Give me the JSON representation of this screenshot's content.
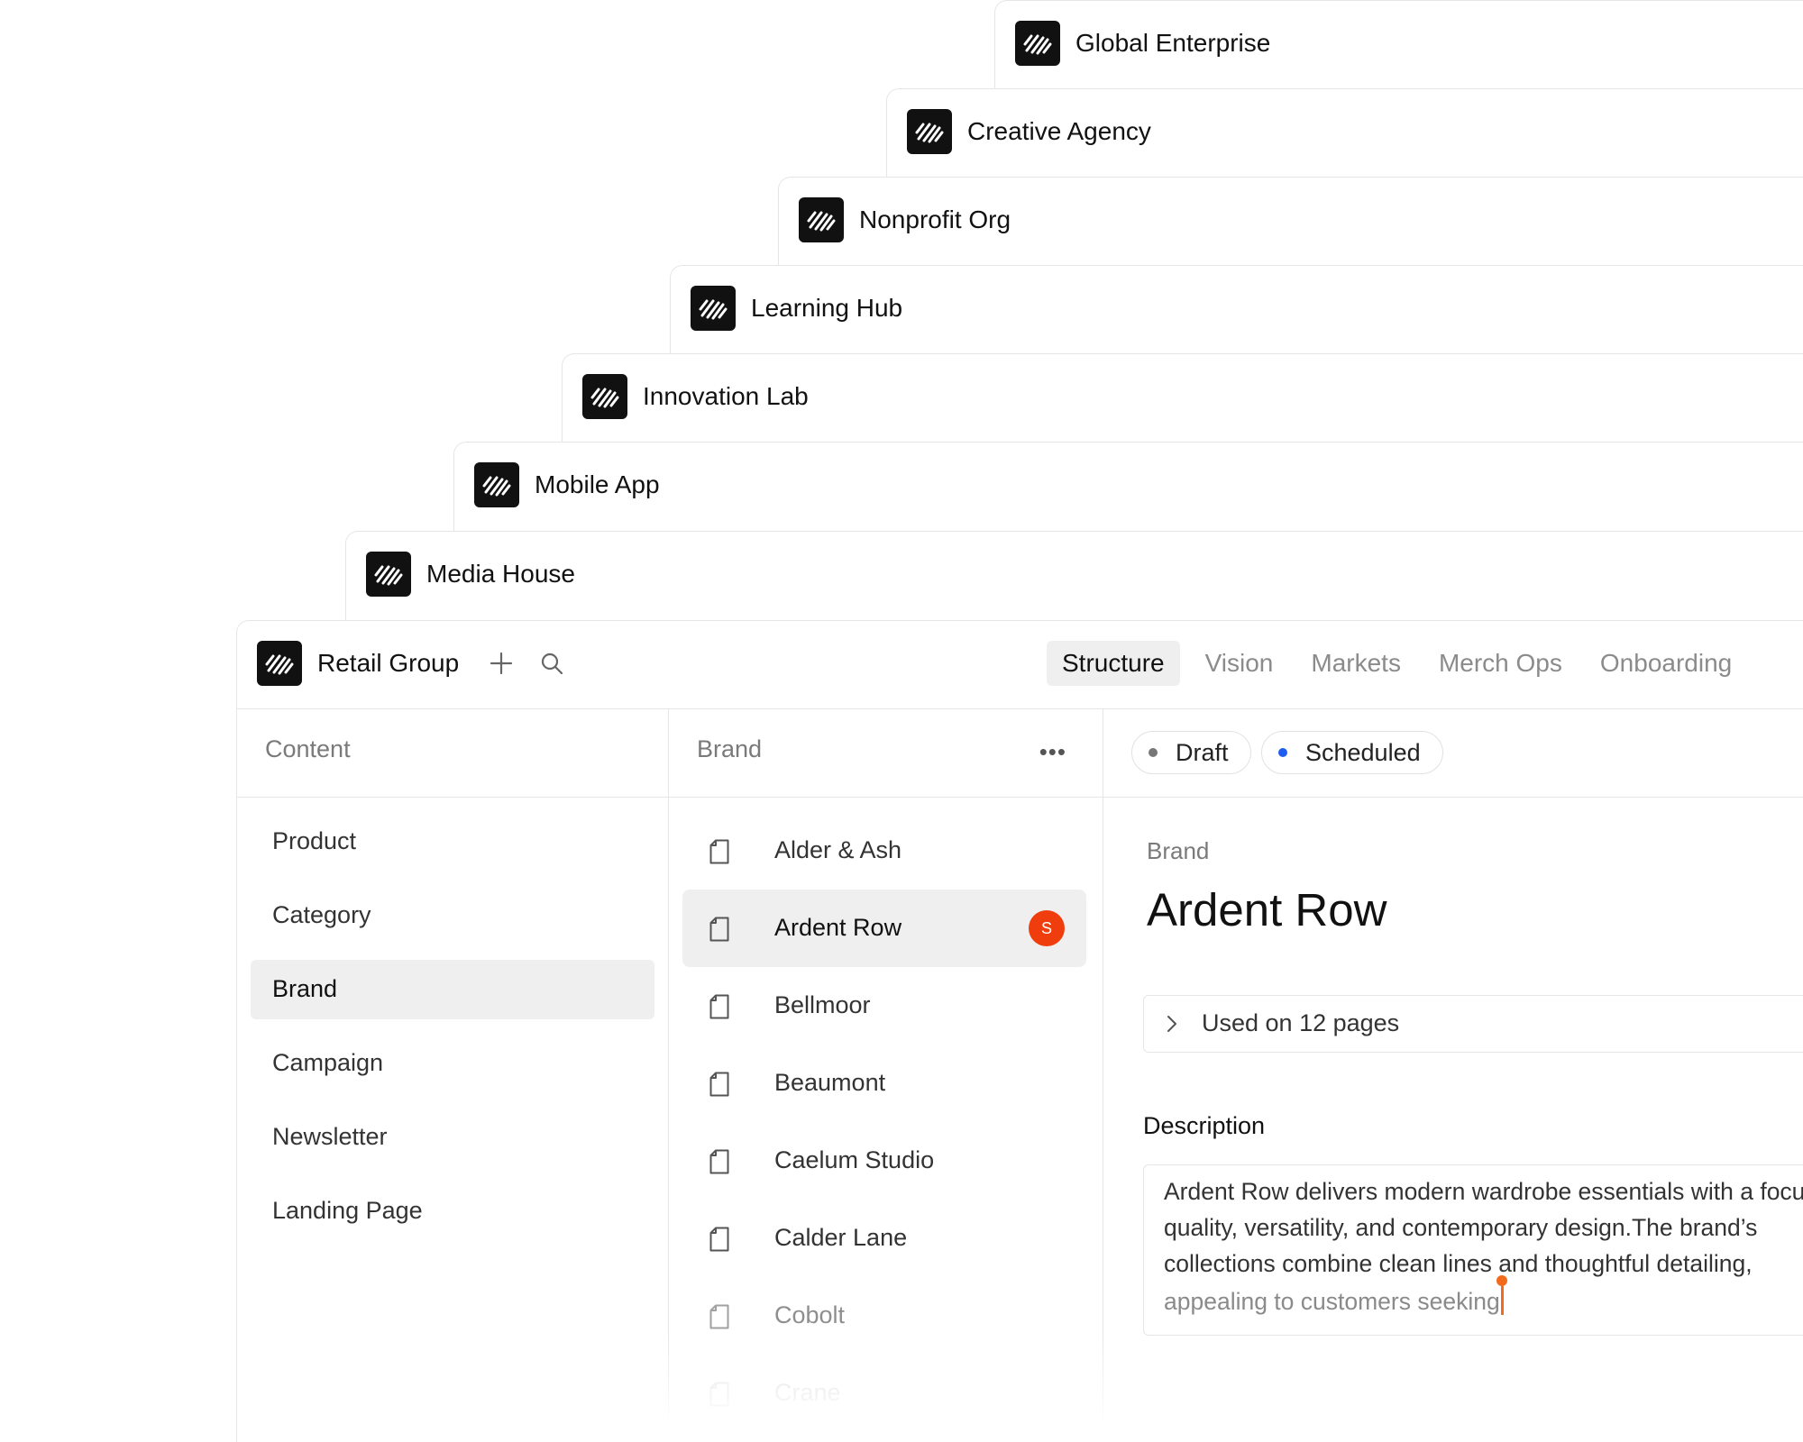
{
  "workspaces": [
    {
      "name": "Global Enterprise",
      "icon": "workspace-logo-icon"
    },
    {
      "name": "Creative Agency",
      "icon": "workspace-logo-icon"
    },
    {
      "name": "Nonprofit Org",
      "icon": "workspace-logo-icon"
    },
    {
      "name": "Learning Hub",
      "icon": "workspace-logo-icon"
    },
    {
      "name": "Innovation Lab",
      "icon": "workspace-logo-icon"
    },
    {
      "name": "Mobile App",
      "icon": "workspace-logo-icon"
    },
    {
      "name": "Media House",
      "icon": "workspace-logo-icon"
    }
  ],
  "app": {
    "workspace_name": "Retail Group",
    "add_icon": "plus-icon",
    "search_icon": "search-icon",
    "tabs": [
      {
        "label": "Structure",
        "active": true
      },
      {
        "label": "Vision"
      },
      {
        "label": "Markets"
      },
      {
        "label": "Merch Ops"
      },
      {
        "label": "Onboarding"
      }
    ]
  },
  "content_column": {
    "title": "Content",
    "items": [
      {
        "label": "Product"
      },
      {
        "label": "Category"
      },
      {
        "label": "Brand",
        "active": true
      },
      {
        "label": "Campaign"
      },
      {
        "label": "Newsletter"
      },
      {
        "label": "Landing Page"
      }
    ]
  },
  "list_column": {
    "title": "Brand",
    "more_icon": "more-horizontal-icon",
    "items": [
      {
        "label": "Alder & Ash"
      },
      {
        "label": "Ardent Row",
        "active": true,
        "avatar": "S"
      },
      {
        "label": "Bellmoor"
      },
      {
        "label": "Beaumont"
      },
      {
        "label": "Caelum Studio"
      },
      {
        "label": "Calder Lane"
      },
      {
        "label": "Cobolt"
      },
      {
        "label": "Crane"
      }
    ]
  },
  "detail": {
    "status_pills": [
      {
        "label": "Draft",
        "color": "#777777"
      },
      {
        "label": "Scheduled",
        "color": "#1f5cf0"
      }
    ],
    "type_label": "Brand",
    "title": "Ardent Row",
    "used_on": "Used on 12  pages",
    "description_label": "Description",
    "description_lines": [
      "Ardent Row delivers modern wardrobe essentials with a focus on",
      "quality, versatility, and contemporary design.The brand’s",
      "collections combine clean lines and thoughtful detailing,",
      "appealing to customers seeking"
    ]
  },
  "colors": {
    "accent_avatar": "#f03d0d",
    "cursor": "#f26a1b",
    "scheduled_dot": "#1f5cf0"
  }
}
